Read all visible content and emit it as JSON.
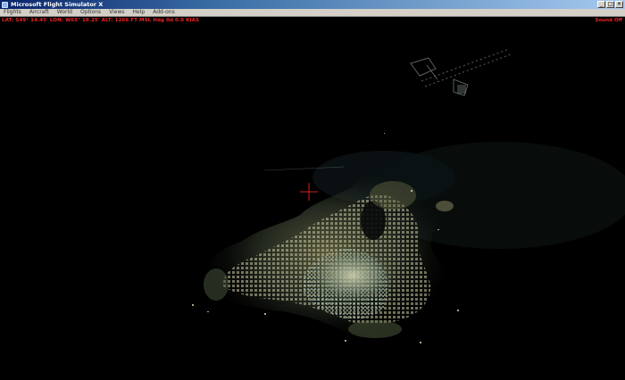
{
  "window": {
    "title": "Microsoft Flight Simulator X",
    "minimize_glyph": "_",
    "maximize_glyph": "□",
    "close_glyph": "✕"
  },
  "menu": [
    "Flights",
    "Aircraft",
    "World",
    "Options",
    "Views",
    "Help",
    "Add-ons"
  ],
  "hud": {
    "readout": "LAT: S49° 14.45'  LON: W65° 19.25'  ALT: 1266 FT  MSL    Hdg 0d   0.0 KIAS",
    "sound_status": "Sound Off"
  },
  "colors": {
    "hud_text": "#ee2222",
    "crosshair": "#cc2222",
    "city_lights_warm": "#d8cf9a",
    "city_lights_cool": "#9fc4c0"
  },
  "icons": {
    "app": "flight-simulator-icon",
    "crosshair": "crosshair-icon"
  }
}
